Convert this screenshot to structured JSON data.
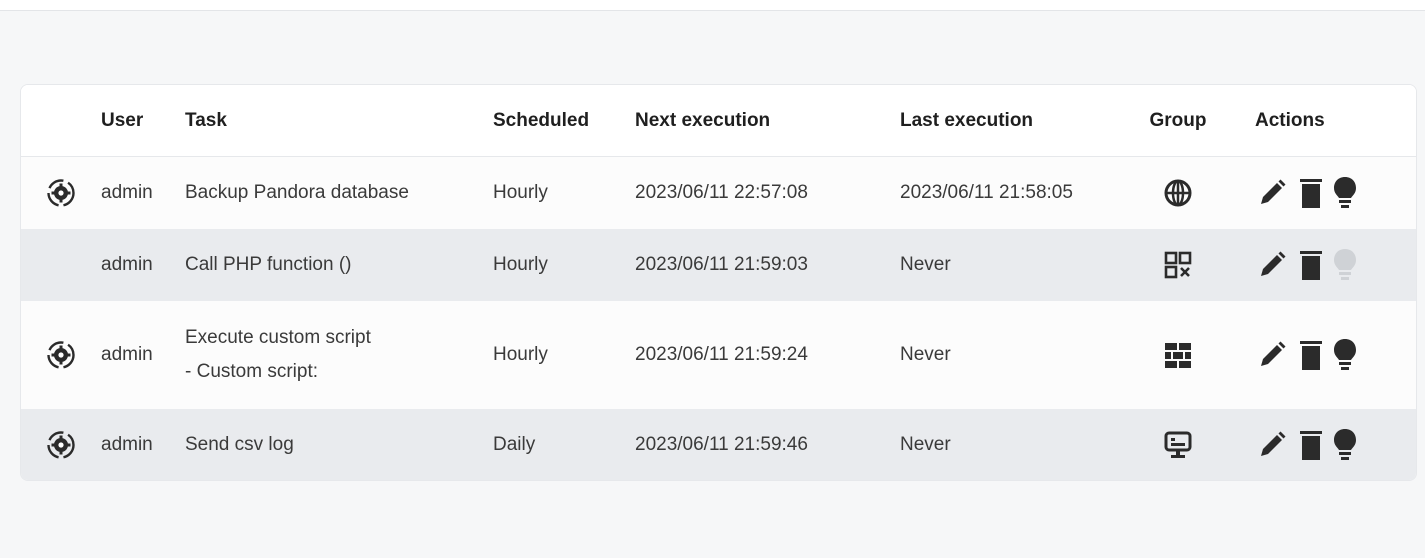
{
  "table": {
    "columns": {
      "user": "User",
      "task": "Task",
      "scheduled": "Scheduled",
      "next_execution": "Next execution",
      "last_execution": "Last execution",
      "group": "Group",
      "actions": "Actions"
    },
    "rows": [
      {
        "running_icon": "gear-cycle-icon",
        "user": "admin",
        "task": "Backup Pandora database",
        "scheduled": "Hourly",
        "next_execution": "2023/06/11 22:57:08",
        "last_execution": "2023/06/11 21:58:05",
        "group_icon": "globe-icon",
        "actions": [
          "edit-icon",
          "delete-icon",
          "bulb-icon"
        ],
        "enabled": true
      },
      {
        "running_icon": "",
        "user": "admin",
        "task": "Call PHP function ()",
        "scheduled": "Hourly",
        "next_execution": "2023/06/11 21:59:03",
        "last_execution": "Never",
        "group_icon": "grid-x-icon",
        "actions": [
          "edit-icon",
          "delete-icon",
          "bulb-icon"
        ],
        "enabled": false
      },
      {
        "running_icon": "gear-cycle-icon",
        "user": "admin",
        "task": "Execute custom script",
        "task_detail": "- Custom script:",
        "scheduled": "Hourly",
        "next_execution": "2023/06/11 21:59:24",
        "last_execution": "Never",
        "group_icon": "bricks-icon",
        "actions": [
          "edit-icon",
          "delete-icon",
          "bulb-icon"
        ],
        "enabled": true
      },
      {
        "running_icon": "gear-cycle-icon",
        "user": "admin",
        "task": "Send csv log",
        "scheduled": "Daily",
        "next_execution": "2023/06/11 21:59:46",
        "last_execution": "Never",
        "group_icon": "monitor-icon",
        "actions": [
          "edit-icon",
          "delete-icon",
          "bulb-icon"
        ],
        "enabled": true
      }
    ]
  },
  "colors": {
    "row_alt": "#e9ebee",
    "row_base": "#fcfcfc",
    "icon": "#2b2b2b",
    "icon_disabled": "#cfd2d6"
  }
}
